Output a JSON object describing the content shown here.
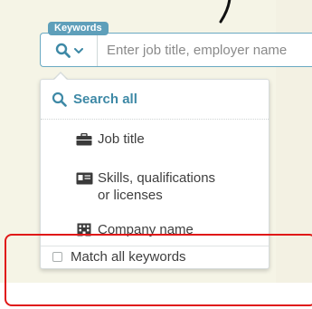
{
  "search": {
    "tag_label": "Keywords",
    "placeholder": "Enter job title, employer name"
  },
  "scope_toggle": {
    "icon": "search-icon",
    "dropdown_icon": "chevron-down-icon"
  },
  "menu": {
    "search_all": {
      "label": "Search all",
      "icon": "search-icon"
    },
    "items": [
      {
        "label": "Job title",
        "icon": "briefcase-icon"
      },
      {
        "label_line1": "Skills, qualifications",
        "label_line2": "or licenses",
        "icon": "id-card-icon"
      },
      {
        "label": "Company name",
        "icon": "building-icon"
      }
    ],
    "match_all": {
      "label": "Match all keywords",
      "checked": false
    }
  },
  "colors": {
    "accent": "#5e9fba",
    "search_all_text": "#3e89a6",
    "highlight": "#e01818",
    "background": "#f5f4e6"
  }
}
